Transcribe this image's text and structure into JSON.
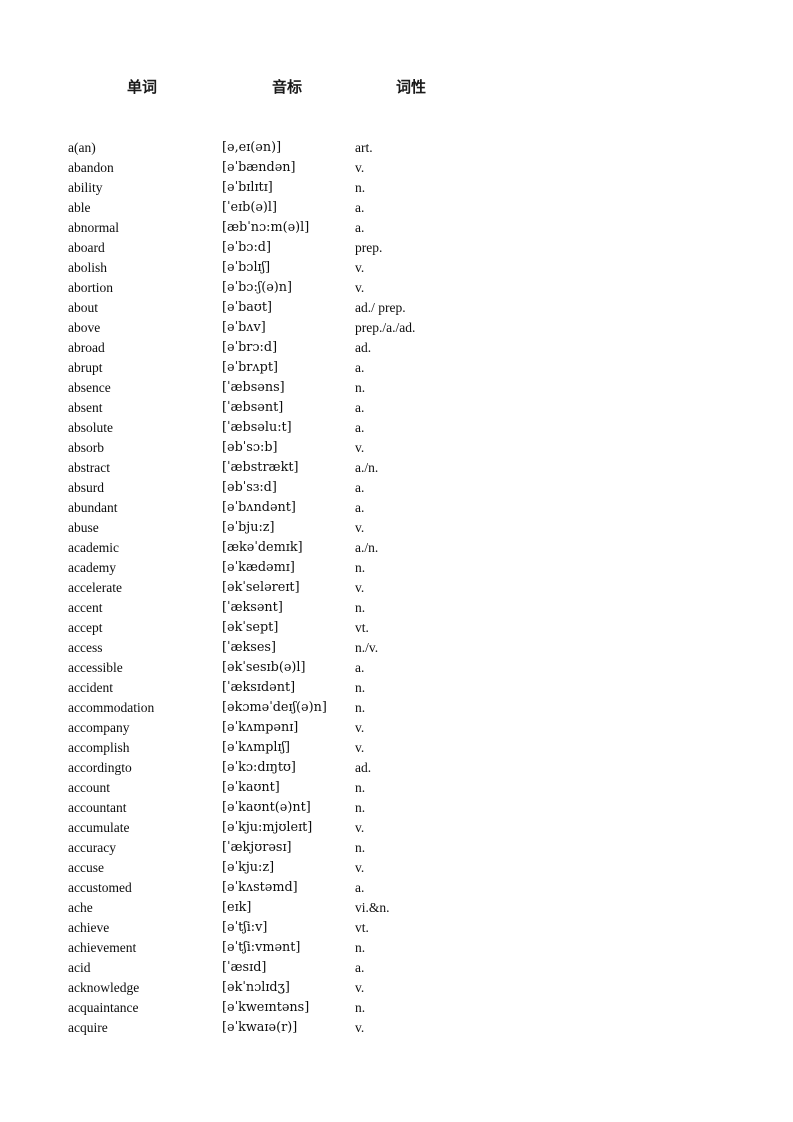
{
  "header": {
    "word_label": "单词",
    "phonetic_label": "音标",
    "pos_label": "词性"
  },
  "rows": [
    {
      "word": "a(an)",
      "phonetic": "[ə,eɪ(ən)]",
      "pos": "art."
    },
    {
      "word": "abandon",
      "phonetic": "[əˈbændən]",
      "pos": "v."
    },
    {
      "word": "ability",
      "phonetic": "[əˈbɪlɪtɪ]",
      "pos": "n."
    },
    {
      "word": "able",
      "phonetic": "[ˈeɪb(ə)l]",
      "pos": "a."
    },
    {
      "word": "abnormal",
      "phonetic": "[æbˈnɔ:m(ə)l]",
      "pos": "a."
    },
    {
      "word": "aboard",
      "phonetic": "[əˈbɔ:d]",
      "pos": "prep."
    },
    {
      "word": "abolish",
      "phonetic": "[əˈbɔlɪʃ]",
      "pos": "v."
    },
    {
      "word": "abortion",
      "phonetic": "[əˈbɔ:ʃ(ə)n]",
      "pos": "v."
    },
    {
      "word": "about",
      "phonetic": "[əˈbaʊt]",
      "pos": "ad./ prep."
    },
    {
      "word": "above",
      "phonetic": "[əˈbʌv]",
      "pos": "prep./a./ad."
    },
    {
      "word": "abroad",
      "phonetic": "[əˈbrɔ:d]",
      "pos": "ad."
    },
    {
      "word": "abrupt",
      "phonetic": "[əˈbrʌpt]",
      "pos": "a."
    },
    {
      "word": "absence",
      "phonetic": "[ˈæbsəns]",
      "pos": "n."
    },
    {
      "word": "absent",
      "phonetic": "[ˈæbsənt]",
      "pos": "a."
    },
    {
      "word": "absolute",
      "phonetic": "[ˈæbsəlu:t]",
      "pos": "a."
    },
    {
      "word": "absorb",
      "phonetic": "[əbˈsɔ:b]",
      "pos": "v."
    },
    {
      "word": "abstract",
      "phonetic": "[ˈæbstrækt]",
      "pos": "a./n."
    },
    {
      "word": "absurd",
      "phonetic": "[əbˈsɜ:d]",
      "pos": "a."
    },
    {
      "word": "abundant",
      "phonetic": "[əˈbʌndənt]",
      "pos": "a."
    },
    {
      "word": "abuse",
      "phonetic": "[əˈbju:z]",
      "pos": "v."
    },
    {
      "word": "academic",
      "phonetic": "[ækəˈdemɪk]",
      "pos": "a./n."
    },
    {
      "word": "academy",
      "phonetic": "[əˈkædəmɪ]",
      "pos": "n."
    },
    {
      "word": "accelerate",
      "phonetic": "[əkˈseləreɪt]",
      "pos": "v."
    },
    {
      "word": "accent",
      "phonetic": "[ˈæksənt]",
      "pos": "n."
    },
    {
      "word": "accept",
      "phonetic": "[əkˈsept]",
      "pos": "vt."
    },
    {
      "word": "access",
      "phonetic": "[ˈækses]",
      "pos": "n./v."
    },
    {
      "word": "accessible",
      "phonetic": "[əkˈsesɪb(ə)l]",
      "pos": "a."
    },
    {
      "word": "accident",
      "phonetic": "[ˈæksɪdənt]",
      "pos": "n."
    },
    {
      "word": "accommodation",
      "phonetic": "[əkɔməˈdeɪʃ(ə)n]",
      "pos": "n."
    },
    {
      "word": "accompany",
      "phonetic": "[əˈkʌmpənɪ]",
      "pos": "v."
    },
    {
      "word": "accomplish",
      "phonetic": "[əˈkʌmplɪʃ]",
      "pos": "v."
    },
    {
      "word": "accordingto",
      "phonetic": "[əˈkɔ:dɪŋtʊ]",
      "pos": "ad."
    },
    {
      "word": "account",
      "phonetic": "[əˈkaʊnt]",
      "pos": "n."
    },
    {
      "word": "accountant",
      "phonetic": "[əˈkaʊnt(ə)nt]",
      "pos": "n."
    },
    {
      "word": "accumulate",
      "phonetic": "[əˈkju:mjʊleɪt]",
      "pos": "v."
    },
    {
      "word": "accuracy",
      "phonetic": "[ˈækjʊrəsɪ]",
      "pos": "n."
    },
    {
      "word": "accuse",
      "phonetic": "[əˈkju:z]",
      "pos": "v."
    },
    {
      "word": "accustomed",
      "phonetic": "[əˈkʌstəmd]",
      "pos": "a."
    },
    {
      "word": "ache",
      "phonetic": "[eɪk]",
      "pos": "vi.&n."
    },
    {
      "word": "achieve",
      "phonetic": "[əˈtʃi:v]",
      "pos": "vt."
    },
    {
      "word": "achievement",
      "phonetic": "[əˈtʃi:vmənt]",
      "pos": "n."
    },
    {
      "word": "acid",
      "phonetic": "[ˈæsɪd]",
      "pos": "a."
    },
    {
      "word": "acknowledge",
      "phonetic": "[əkˈnɔlɪdʒ]",
      "pos": "v."
    },
    {
      "word": "acquaintance",
      "phonetic": "[əˈkweɪntəns]",
      "pos": "n."
    },
    {
      "word": "acquire",
      "phonetic": "[əˈkwaɪə(r)]",
      "pos": "v."
    }
  ]
}
